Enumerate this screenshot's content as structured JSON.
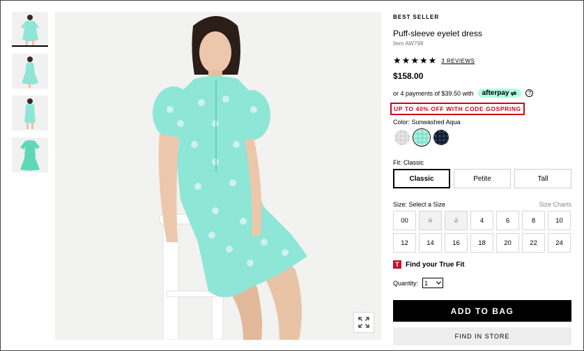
{
  "thumbnails": [
    {
      "alt": "front view"
    },
    {
      "alt": "side view"
    },
    {
      "alt": "back view"
    },
    {
      "alt": "flat lay"
    }
  ],
  "product": {
    "badge": "BEST SELLER",
    "title": "Puff-sleeve eyelet dress",
    "item_number": "Item AW798",
    "rating": 5,
    "reviews_link": "3 REVIEWS",
    "price": "$158.00"
  },
  "afterpay": {
    "text": "or 4 payments of $39.50 with",
    "logo_text": "afterpay",
    "info_icon": "?"
  },
  "promo": {
    "text": "UP TO 40% OFF WITH CODE GOSPRING",
    "color": "#d0021b"
  },
  "color": {
    "label": "Color:",
    "selected": "Sunwashed Aqua",
    "swatches": [
      {
        "name": "white eyelet",
        "hex": "#e3e3e3"
      },
      {
        "name": "Sunwashed Aqua",
        "hex": "#7fe3cf"
      },
      {
        "name": "navy eyelet",
        "hex": "#141c33"
      }
    ]
  },
  "fit": {
    "label": "Fit:",
    "selected": "Classic",
    "options": [
      "Classic",
      "Petite",
      "Tall"
    ]
  },
  "size": {
    "label": "Size:",
    "prompt": "Select a Size",
    "charts_link": "Size Charts",
    "options": [
      {
        "label": "00",
        "available": true
      },
      {
        "label": "0",
        "available": false
      },
      {
        "label": "2",
        "available": false
      },
      {
        "label": "4",
        "available": true
      },
      {
        "label": "6",
        "available": true
      },
      {
        "label": "8",
        "available": true
      },
      {
        "label": "10",
        "available": true
      },
      {
        "label": "12",
        "available": true
      },
      {
        "label": "14",
        "available": true
      },
      {
        "label": "16",
        "available": true
      },
      {
        "label": "18",
        "available": true
      },
      {
        "label": "20",
        "available": true
      },
      {
        "label": "22",
        "available": true
      },
      {
        "label": "24",
        "available": true
      }
    ]
  },
  "truefit": {
    "logo": "T",
    "label": "Find your True Fit"
  },
  "quantity": {
    "label": "Quantity:",
    "value": "1"
  },
  "actions": {
    "add_to_bag": "ADD TO BAG",
    "find_in_store": "FIND IN STORE"
  },
  "icons": {
    "zoom": "expand-icon",
    "star": "star-icon",
    "dropdown": "chevron-down-icon"
  },
  "colors": {
    "dress": "#8ee6d6",
    "promo_border": "#d0021b",
    "truefit": "#c8102e",
    "afterpay_bg": "#b2fce4"
  }
}
